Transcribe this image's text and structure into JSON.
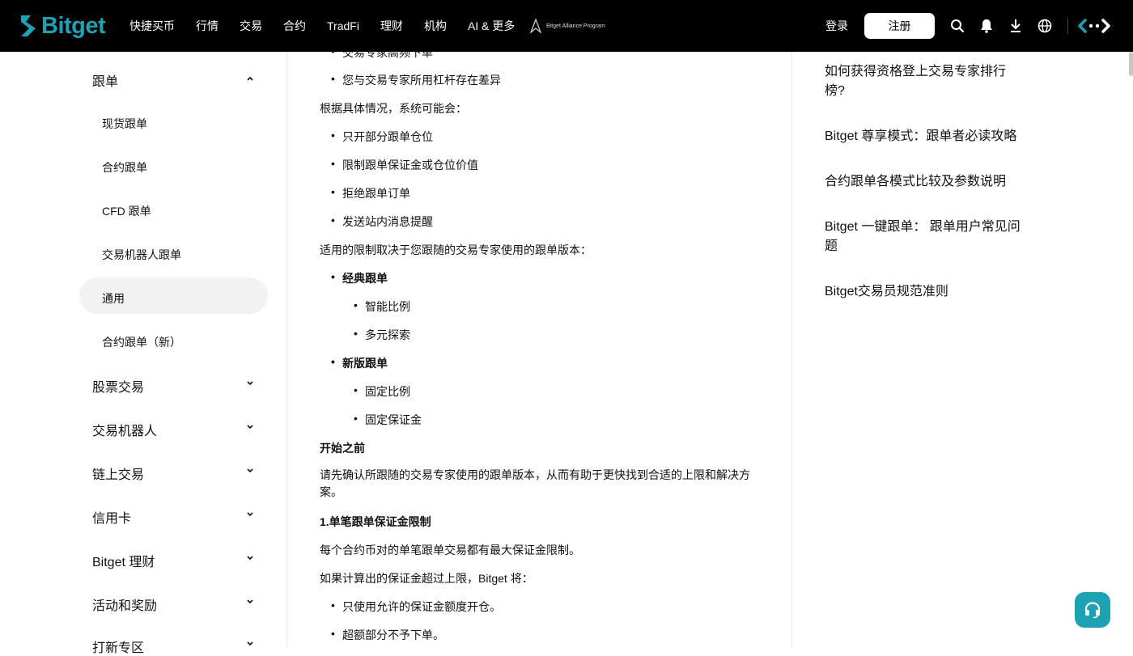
{
  "nav": {
    "logo": "Bitget",
    "items": [
      "快捷买币",
      "行情",
      "交易",
      "合约",
      "TradFi",
      "理财",
      "机构",
      "AI & 更多"
    ],
    "alliance": "Bitget Alliance Program",
    "login": "登录",
    "register": "注册",
    "icons": [
      "search-icon",
      "bell-icon",
      "download-icon",
      "globe-icon",
      "bitget-wallet-icon"
    ]
  },
  "sidebar": {
    "open_section": "跟单",
    "sub_items": [
      "现货跟单",
      "合约跟单",
      "CFD 跟单",
      "交易机器人跟单",
      "通用",
      "合约跟单（新）"
    ],
    "active_sub_index": 4,
    "sections": [
      "股票交易",
      "交易机器人",
      "链上交易",
      "信用卡",
      "Bitget 理财",
      "活动和奖励",
      "打新专区"
    ]
  },
  "content": {
    "top_partial": "交易专家高频下单",
    "bullet_leverage": "您与交易专家所用杠杆存在差异",
    "para_system": "根据具体情况，系统可能会：",
    "system_actions": [
      "只开部分跟单仓位",
      "限制跟单保证金或仓位价值",
      "拒绝跟单订单",
      "发送站内消息提醒"
    ],
    "para_version": "适用的限制取决于您跟随的交易专家使用的跟单版本：",
    "classic": "经典跟单",
    "classic_items": [
      "智能比例",
      "多元探索"
    ],
    "new_version": "新版跟单",
    "new_items": [
      "固定比例",
      "固定保证金"
    ],
    "before_heading": "开始之前",
    "before_text": "请先确认所跟随的交易专家使用的跟单版本，从而有助于更快找到合适的上限和解决方案。",
    "limit_heading": "1.单笔跟单保证金限制",
    "limit_text": "每个合约币对的单笔跟单交易都有最大保证金限制。",
    "exceed_text": "如果计算出的保证金超过上限，Bitget 将：",
    "exceed_items": [
      "只使用允许的保证金额度开仓。",
      "超额部分不予下单。"
    ]
  },
  "related": [
    "如何获得资格登上交易专家排行榜?",
    "Bitget 尊享模式：跟单者必读攻略",
    "合约跟单各模式比较及参数说明",
    "Bitget 一键跟单：  跟单用户常见问题",
    "Bitget交易员规范准则"
  ],
  "colors": {
    "brand": "#1da2b4",
    "nav_bg": "#000000",
    "active_bg": "#f2f2f2"
  }
}
